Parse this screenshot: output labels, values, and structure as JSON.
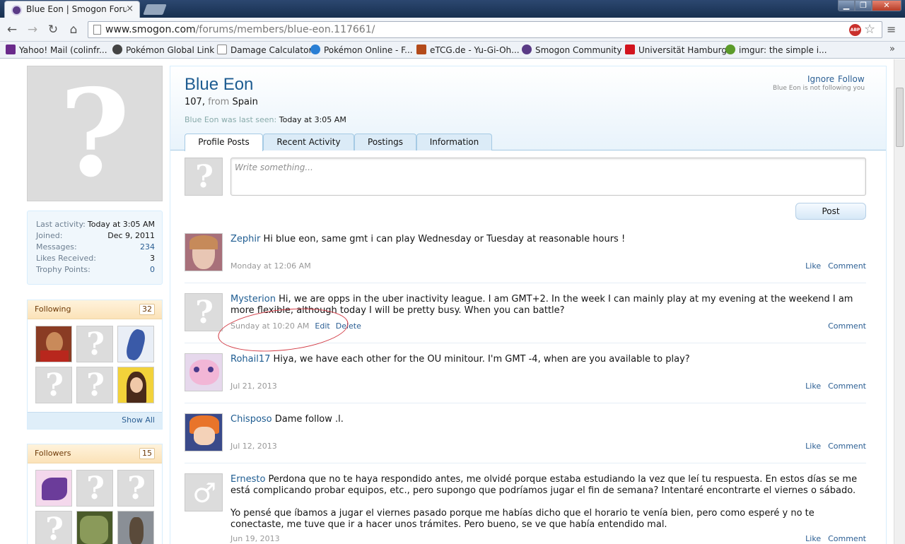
{
  "browser": {
    "tab_title": "Blue Eon | Smogon Forum",
    "tab_close": "×",
    "url_host": "www.smogon.com",
    "url_path": "/forums/members/blue-eon.117661/",
    "abp_label": "ABP",
    "star": "☆",
    "menu": "≡",
    "back": "←",
    "forward": "→",
    "reload": "↻",
    "home": "⌂",
    "win_min": "▁",
    "win_max": "❐",
    "win_close": "✕",
    "bookmarks": [
      {
        "label": "Yahoo! Mail (colinfr...",
        "color": "#6a2a8b"
      },
      {
        "label": "Pokémon Global Link",
        "color": "#444"
      },
      {
        "label": "Damage Calculator",
        "color": "#fff"
      },
      {
        "label": "Pokémon Online - F...",
        "color": "#2a7fd4"
      },
      {
        "label": "eTCG.de - Yu-Gi-Oh...",
        "color": "#b34a1a"
      },
      {
        "label": "Smogon Community",
        "color": "#5a3b86"
      },
      {
        "label": "Universität Hamburg",
        "color": "#d2141e"
      },
      {
        "label": "imgur: the simple i...",
        "color": "#5c9b2b"
      }
    ],
    "bookmarks_more": "»"
  },
  "sidebar": {
    "info": [
      {
        "key": "Last activity:",
        "value": "Today at 3:05 AM"
      },
      {
        "key": "Joined:",
        "value": "Dec 9, 2011"
      },
      {
        "key": "Messages:",
        "value": "234"
      },
      {
        "key": "Likes Received:",
        "value": "3"
      },
      {
        "key": "Trophy Points:",
        "value": "0"
      }
    ],
    "following": {
      "label": "Following",
      "count": "32",
      "show_all": "Show All"
    },
    "followers": {
      "label": "Followers",
      "count": "15"
    }
  },
  "profile": {
    "username": "Blue Eon",
    "title_number": "107,",
    "from_label": "from",
    "location": "Spain",
    "last_seen_label": "Blue Eon was last seen:",
    "last_seen_value": "Today at 3:05 AM",
    "ignore": "Ignore",
    "follow": "Follow",
    "not_following": "Blue Eon is not following you",
    "tabs": [
      "Profile Posts",
      "Recent Activity",
      "Postings",
      "Information"
    ],
    "composer_placeholder": "Write something...",
    "post_button": "Post"
  },
  "messages": [
    {
      "name": "Zephir",
      "text": "Hi blue eon, same gmt i can play Wednesday or Tuesday at reasonable hours !",
      "time": "Monday at 12:06 AM",
      "like": "Like",
      "comment": "Comment"
    },
    {
      "name": "Mysterion",
      "text": "Hi, we are opps in the uber inactivity league. I am GMT+2. In the week I can mainly play at my evening at the weekend I am more flexible, although today I will be pretty busy. When you can battle?",
      "time": "Sunday at 10:20 AM",
      "edit": "Edit",
      "delete": "Delete",
      "comment": "Comment"
    },
    {
      "name": "Rohail17",
      "text": "Hiya, we have each other for the OU minitour. I'm GMT -4, when are you available to play?",
      "time": "Jul 21, 2013",
      "like": "Like",
      "comment": "Comment"
    },
    {
      "name": "Chisposo",
      "text": "Dame follow .l.",
      "time": "Jul 12, 2013",
      "like": "Like",
      "comment": "Comment"
    },
    {
      "name": "Ernesto",
      "text": "Perdona que no te haya respondido antes, me olvidé porque estaba estudiando la vez que leí tu respuesta. En estos días se me está complicando probar equipos, etc., pero supongo que podríamos jugar el fin de semana? Intentaré encontrarte el viernes o sábado.",
      "text2": "Yo pensé que íbamos a jugar el viernes pasado porque me habías dicho que el horario te venía bien, pero como esperé y no te conectaste, me tuve que ir a hacer unos trámites. Pero bueno, se ve que había entendido mal.",
      "time": "Jun 19, 2013",
      "like": "Like",
      "comment": "Comment"
    }
  ]
}
